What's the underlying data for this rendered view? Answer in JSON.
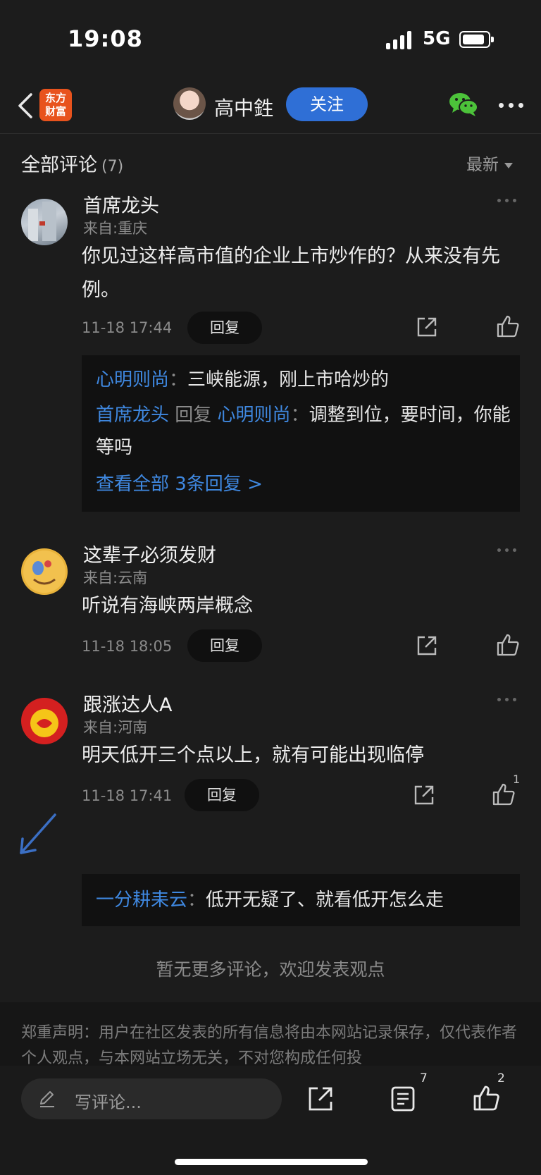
{
  "status": {
    "time": "19:08",
    "network": "5G"
  },
  "nav": {
    "logo_text_1": "东方",
    "logo_text_2": "财富",
    "author": "高中鉎",
    "follow": "关注"
  },
  "section": {
    "title": "全部评论",
    "count": "(7)",
    "sort": "最新"
  },
  "comments": [
    {
      "user": "首席龙头",
      "region": "来自:重庆",
      "text": "你见过这样高市值的企业上市炒作的？从来没有先例。",
      "time": "11-18 17:44",
      "reply_label": "回复",
      "likes": "",
      "replies": [
        {
          "user": "心明则尚",
          "sep": "：",
          "text": "三峡能源，刚上市哈炒的"
        },
        {
          "user": "首席龙头",
          "mid": " 回复 ",
          "target": "心明则尚",
          "sep": "：",
          "text": "调整到位，要时间，你能等吗"
        }
      ],
      "view_all": "查看全部 3条回复 >"
    },
    {
      "user": "这辈子必须发财",
      "region": "来自:云南",
      "text": "听说有海峡两岸概念",
      "time": "11-18 18:05",
      "reply_label": "回复",
      "likes": ""
    },
    {
      "user": "跟涨达人A",
      "region": "来自:河南",
      "text": "明天低开三个点以上，就有可能出现临停",
      "time": "11-18 17:41",
      "reply_label": "回复",
      "likes": "1",
      "replies": [
        {
          "user": "一分耕耒云",
          "sep": "：",
          "text": "低开无疑了、就看低开怎么走"
        }
      ]
    }
  ],
  "no_more": "暂无更多评论，欢迎发表观点",
  "disclaimer": "郑重声明：用户在社区发表的所有信息将由本网站记录保存，仅代表作者个人观点，与本网站立场无关，不对您构成任何投",
  "bottom": {
    "placeholder": "写评论...",
    "list_count": "7",
    "like_count": "2"
  },
  "colors": {
    "accent": "#2f6fd6",
    "link": "#3f88e0",
    "bg": "#1c1c1c",
    "logo": "#e8531d"
  }
}
